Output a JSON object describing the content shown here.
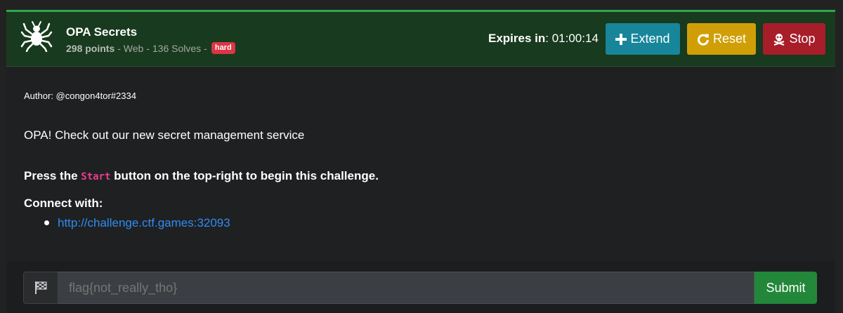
{
  "challenge": {
    "title": "OPA Secrets",
    "points": "298 points",
    "category": " - Web - ",
    "solves": "136 Solves",
    "separator": " - ",
    "difficulty": "hard",
    "icon": "spider-icon"
  },
  "timer": {
    "label": "Expires in",
    "colon": ": ",
    "value": "01:00:14"
  },
  "buttons": {
    "extend": "Extend",
    "reset": "Reset",
    "stop": "Stop"
  },
  "body": {
    "author": "Author: @congon4tor#2334",
    "description": "OPA! Check out our new secret management service",
    "press_prefix": "Press the ",
    "press_code": "Start",
    "press_suffix": " button on the top-right to begin this challenge.",
    "connect_label": "Connect with:",
    "connect_link": "http://challenge.ctf.games:32093"
  },
  "flag_form": {
    "placeholder": "flag{not_really_tho}",
    "submit": "Submit"
  },
  "colors": {
    "accent_green": "#2ea84a",
    "header_bg": "#183a1e",
    "extend": "#17869a",
    "reset": "#d09f07",
    "stop": "#a71d2a",
    "badge": "#dc3545",
    "link": "#2f8cf3"
  }
}
